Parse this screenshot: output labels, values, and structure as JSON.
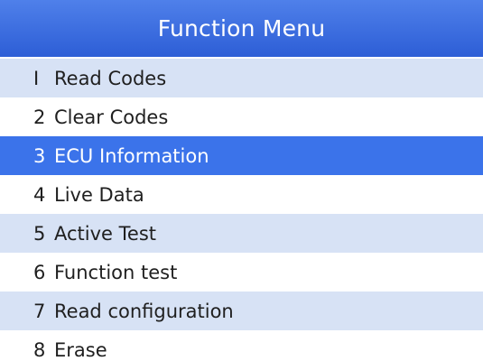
{
  "window": {
    "title": "Function Menu"
  },
  "menu": {
    "selected_index": 2,
    "items": [
      {
        "number": "I",
        "label": "Read Codes"
      },
      {
        "number": "2",
        "label": "Clear Codes"
      },
      {
        "number": "3",
        "label": "ECU Information"
      },
      {
        "number": "4",
        "label": "Live Data"
      },
      {
        "number": "5",
        "label": "Active Test"
      },
      {
        "number": "6",
        "label": "Function test"
      },
      {
        "number": "7",
        "label": "Read configuration"
      },
      {
        "number": "8",
        "label": "Erase"
      }
    ]
  },
  "colors": {
    "title_bar": "#3a6be0",
    "selected_row": "#3b73ea",
    "alternate_row": "#d7e2f5",
    "text": "#1f1f1f"
  }
}
